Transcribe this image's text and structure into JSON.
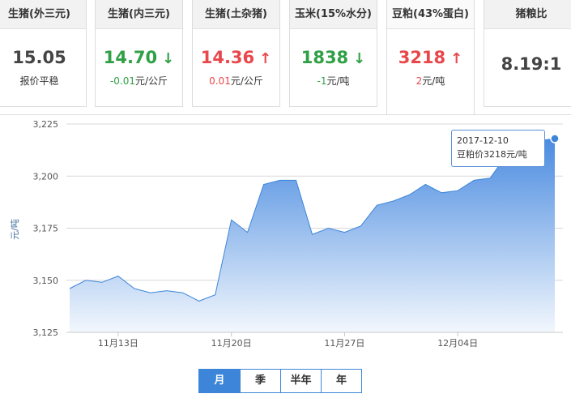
{
  "cards": [
    {
      "title": "生猪(外三元)",
      "value": "15.05",
      "arrow": "",
      "direction": "flat",
      "sub": "报价平稳",
      "sub_unit": ""
    },
    {
      "title": "生猪(内三元)",
      "value": "14.70",
      "arrow": "↓",
      "direction": "down",
      "sub": "-0.01",
      "sub_unit": "元/公斤"
    },
    {
      "title": "生猪(土杂猪)",
      "value": "14.36",
      "arrow": "↑",
      "direction": "up",
      "sub": "0.01",
      "sub_unit": "元/公斤"
    },
    {
      "title": "玉米(15%水分)",
      "value": "1838",
      "arrow": "↓",
      "direction": "down",
      "sub": "-1",
      "sub_unit": "元/吨"
    },
    {
      "title": "豆粕(43%蛋白)",
      "value": "3218",
      "arrow": "↑",
      "direction": "up",
      "sub": "2",
      "sub_unit": "元/吨"
    },
    {
      "title": "猪粮比",
      "value": "8.19:1",
      "arrow": "",
      "direction": "flat",
      "sub": "",
      "sub_unit": ""
    }
  ],
  "tooltip": {
    "date": "2017-12-10",
    "label": "豆粕价3218",
    "unit": "元/吨"
  },
  "range_tabs": [
    "月",
    "季",
    "半年",
    "年"
  ],
  "active_range": "月",
  "colors": {
    "up": "#e8484c",
    "down": "#30a047",
    "accent": "#3d85d8",
    "area_top": "#4a8be0",
    "area_bottom": "#f2f7fd"
  },
  "chart_data": {
    "type": "area",
    "ylabel": "元/吨",
    "ylim": [
      3125,
      3225
    ],
    "yticks": [
      3125,
      3150,
      3175,
      3200,
      3225
    ],
    "ytick_labels": [
      "3,125",
      "3,150",
      "3,175",
      "3,200",
      "3,225"
    ],
    "xtick_labels": [
      "11月13日",
      "11月20日",
      "11月27日",
      "12月04日"
    ],
    "xtick_index": [
      3,
      10,
      17,
      24
    ],
    "grid": true,
    "series": [
      {
        "values": [
          3146,
          3150,
          3149,
          3152,
          3146,
          3144,
          3145,
          3144,
          3140,
          3143,
          3179,
          3173,
          3196,
          3198,
          3198,
          3172,
          3175,
          3173,
          3176,
          3186,
          3188,
          3191,
          3196,
          3192,
          3193,
          3198,
          3199,
          3210,
          3215,
          3217,
          3218
        ]
      }
    ]
  }
}
